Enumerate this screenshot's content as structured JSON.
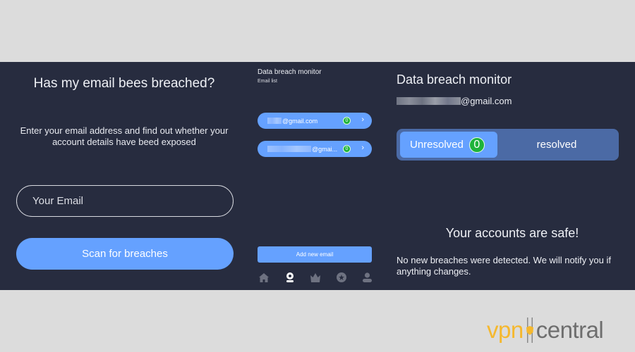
{
  "panel_signup": {
    "title": "Has my email bees breached?",
    "description": "Enter your email address and find out whether your account details have beed exposed",
    "email_placeholder": "Your Email",
    "scan_button": "Scan for breaches"
  },
  "panel_email_list": {
    "title": "Data breach monitor",
    "subtitle": "Email list",
    "emails": [
      {
        "visible_text": "@gmail.com",
        "breach_count": "0",
        "chevron": "›"
      },
      {
        "visible_text": "@gmai...",
        "breach_count": "0",
        "chevron": "›"
      }
    ],
    "add_button": "Add new email",
    "nav": [
      {
        "icon": "home-icon",
        "active": false
      },
      {
        "icon": "webcam-icon",
        "active": true
      },
      {
        "icon": "crown-icon",
        "active": false
      },
      {
        "icon": "star-icon",
        "active": false
      },
      {
        "icon": "profile-icon",
        "active": false
      }
    ]
  },
  "panel_monitor": {
    "title": "Data breach monitor",
    "email_visible": "@gmail.com",
    "tabs": {
      "unresolved": "Unresolved",
      "unresolved_count": "0",
      "resolved": "resolved"
    },
    "safe_title": "Your accounts are safe!",
    "safe_description": "No new breaches were detected. We will notify you if anything changes."
  },
  "logo": {
    "part1": "vpn",
    "part2": "central"
  },
  "colors": {
    "background": "#272c3f",
    "accent": "#65a1ff",
    "badge_green": "#1fb33b",
    "segment_bg": "#4b6aa5",
    "logo_yellow": "#f5b82e",
    "logo_gray": "#6e6e6e"
  }
}
